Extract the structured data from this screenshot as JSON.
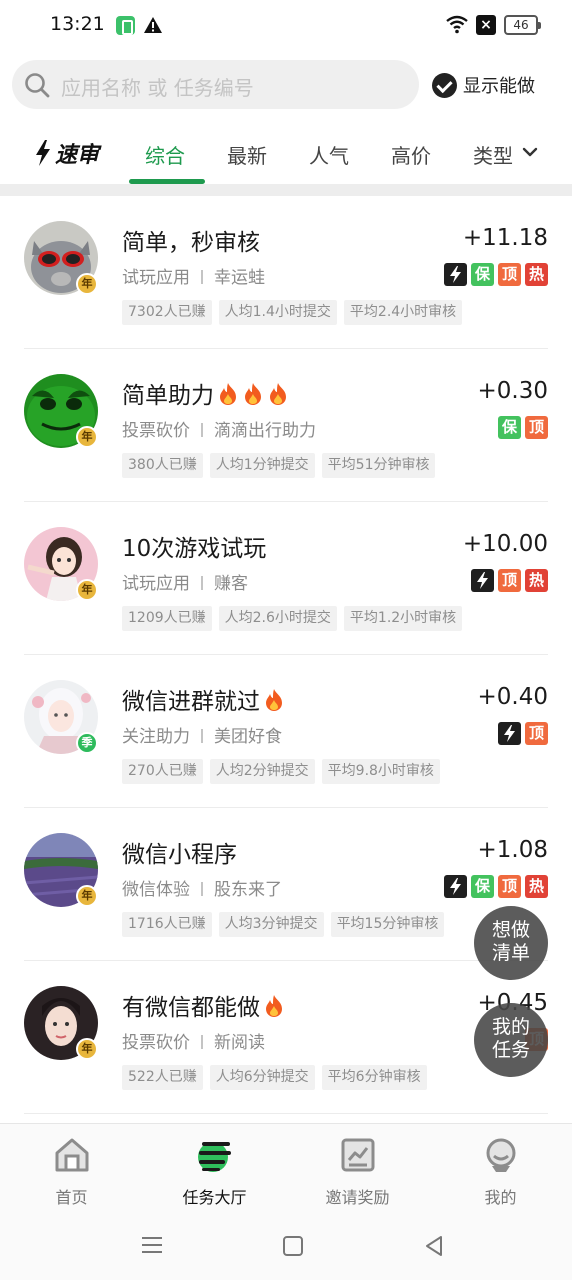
{
  "status_bar": {
    "time": "13:21",
    "battery": "46"
  },
  "search": {
    "placeholder": "应用名称 或 任务编号"
  },
  "filter": {
    "show_doable_label": "显示能做"
  },
  "tabs": {
    "brand": "速审",
    "items": [
      "综合",
      "最新",
      "人气",
      "高价",
      "类型"
    ],
    "active": "综合"
  },
  "tasks": [
    {
      "title": "简单，秒审核",
      "fire_count": 0,
      "price": "+11.18",
      "category": "试玩应用",
      "merchant": "幸运蛙",
      "badges": [
        "bolt",
        "保",
        "顶",
        "热"
      ],
      "avatar_badge": "年",
      "stats": [
        "7302人已赚",
        "人均1.4小时提交",
        "平均2.4小时审核"
      ]
    },
    {
      "title": "简单助力",
      "fire_count": 3,
      "price": "+0.30",
      "category": "投票砍价",
      "merchant": "滴滴出行助力",
      "badges": [
        "保",
        "顶"
      ],
      "avatar_badge": "年",
      "stats": [
        "380人已赚",
        "人均1分钟提交",
        "平均51分钟审核"
      ]
    },
    {
      "title": "10次游戏试玩",
      "fire_count": 0,
      "price": "+10.00",
      "category": "试玩应用",
      "merchant": "赚客",
      "badges": [
        "bolt",
        "顶",
        "热"
      ],
      "avatar_badge": "年",
      "stats": [
        "1209人已赚",
        "人均2.6小时提交",
        "平均1.2小时审核"
      ]
    },
    {
      "title": "微信进群就过",
      "fire_count": 1,
      "price": "+0.40",
      "category": "关注助力",
      "merchant": "美团好食",
      "badges": [
        "bolt",
        "顶"
      ],
      "avatar_badge": "季",
      "stats": [
        "270人已赚",
        "人均2分钟提交",
        "平均9.8小时审核"
      ]
    },
    {
      "title": "微信小程序",
      "fire_count": 0,
      "price": "+1.08",
      "category": "微信体验",
      "merchant": "股东来了",
      "badges": [
        "bolt",
        "保",
        "顶",
        "热"
      ],
      "avatar_badge": "年",
      "stats": [
        "1716人已赚",
        "人均3分钟提交",
        "平均15分钟审核"
      ]
    },
    {
      "title": "有微信都能做",
      "fire_count": 1,
      "price": "+0.45",
      "category": "投票砍价",
      "merchant": "新阅读",
      "badges": [
        "顶"
      ],
      "avatar_badge": "年",
      "stats": [
        "522人已赚",
        "人均6分钟提交",
        "平均6分钟审核"
      ]
    }
  ],
  "fabs": {
    "wish_list": [
      "想做",
      "清单"
    ],
    "my_tasks": [
      "我的",
      "任务"
    ]
  },
  "bottom_nav": {
    "items": [
      "首页",
      "任务大厅",
      "邀请奖励",
      "我的"
    ],
    "active": "任务大厅"
  },
  "colors": {
    "accent": "#1e9a4e",
    "ding": "#f06a3e",
    "re": "#e14236",
    "bao": "#43c25e"
  }
}
